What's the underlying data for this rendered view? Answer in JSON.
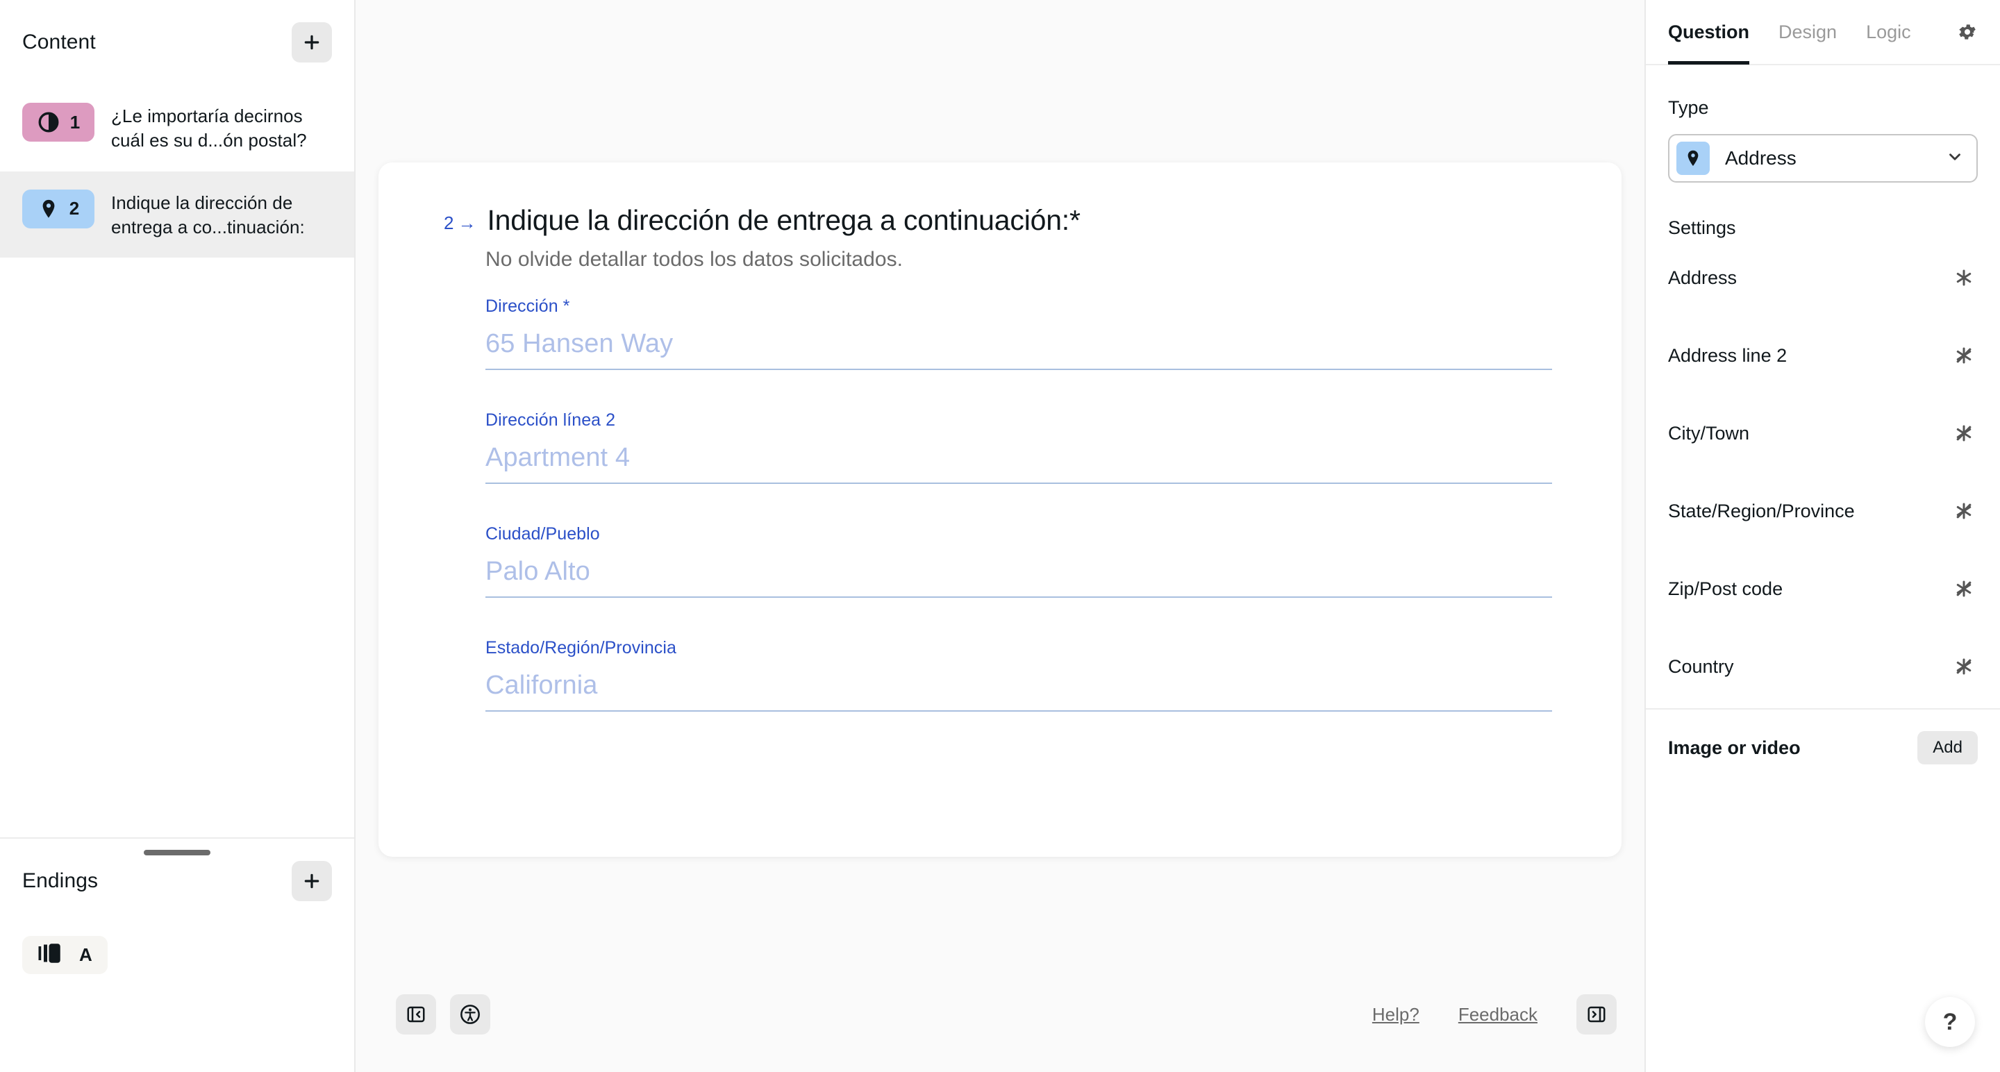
{
  "sidebar": {
    "content_title": "Content",
    "add_button_icon": "plus-icon",
    "questions": [
      {
        "number": "1",
        "icon": "contrast-circle-icon",
        "color": "#dd9bc0",
        "text": "¿Le importaría decirnos cuál es su d...ón postal?",
        "active": false
      },
      {
        "number": "2",
        "icon": "map-pin-icon",
        "color": "#a9d1f7",
        "text": "Indique la dirección de entrega a co...tinuación:",
        "active": true
      }
    ],
    "endings_title": "Endings",
    "endings_add_icon": "plus-icon",
    "ending_item": {
      "icon": "ending-card-icon",
      "letter": "A"
    }
  },
  "main": {
    "question_number": "2",
    "question_arrow": "→",
    "title": "Indique la dirección de entrega a continuación:*",
    "description": "No olvide detallar todos los datos solicitados.",
    "fields": [
      {
        "label": "Dirección *",
        "placeholder": "65 Hansen Way"
      },
      {
        "label": "Dirección línea 2",
        "placeholder": "Apartment 4"
      },
      {
        "label": "Ciudad/Pueblo",
        "placeholder": "Palo Alto"
      },
      {
        "label": "Estado/Región/Provincia",
        "placeholder": "California"
      }
    ]
  },
  "footer": {
    "collapse_left_icon": "panel-collapse-left-icon",
    "accessibility_icon": "accessibility-icon",
    "help_link": "Help?",
    "feedback_link": "Feedback",
    "collapse_right_icon": "panel-collapse-right-icon",
    "help_fab": "?"
  },
  "right_panel": {
    "tabs": [
      {
        "label": "Question",
        "active": true
      },
      {
        "label": "Design",
        "active": false
      },
      {
        "label": "Logic",
        "active": false
      }
    ],
    "gear_icon": "gear-icon",
    "type_label": "Type",
    "type_value": "Address",
    "type_icon": "map-pin-icon",
    "chevron_icon": "chevron-down-icon",
    "settings_title": "Settings",
    "settings": [
      {
        "name": "Address",
        "state": "required",
        "icon": "asterisk-icon"
      },
      {
        "name": "Address line 2",
        "state": "optional",
        "icon": "asterisk-slash-icon"
      },
      {
        "name": "City/Town",
        "state": "optional",
        "icon": "asterisk-slash-icon"
      },
      {
        "name": "State/Region/Province",
        "state": "optional",
        "icon": "asterisk-slash-icon"
      },
      {
        "name": "Zip/Post code",
        "state": "optional",
        "icon": "asterisk-slash-icon"
      },
      {
        "name": "Country",
        "state": "optional",
        "icon": "asterisk-slash-icon"
      }
    ],
    "image_or_video_label": "Image or video",
    "add_label": "Add"
  },
  "colors": {
    "accent_blue": "#2b50c8",
    "pink_badge": "#dd9bc0",
    "blue_badge": "#a9d1f7",
    "field_underline": "#a9bfdf",
    "placeholder": "#aebfe8"
  }
}
